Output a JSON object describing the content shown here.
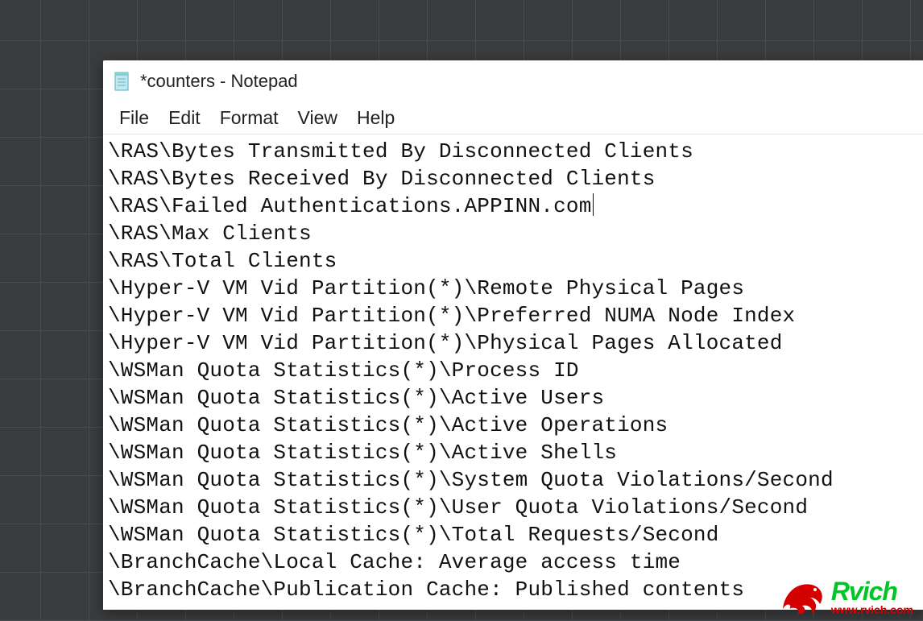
{
  "window": {
    "title": "*counters - Notepad"
  },
  "menu": {
    "file": "File",
    "edit": "Edit",
    "format": "Format",
    "view": "View",
    "help": "Help"
  },
  "editor": {
    "lines": [
      "\\RAS\\Bytes Transmitted By Disconnected Clients",
      "\\RAS\\Bytes Received By Disconnected Clients",
      "\\RAS\\Failed Authentications.APPINN.com",
      "\\RAS\\Max Clients",
      "\\RAS\\Total Clients",
      "\\Hyper-V VM Vid Partition(*)\\Remote Physical Pages",
      "\\Hyper-V VM Vid Partition(*)\\Preferred NUMA Node Index",
      "\\Hyper-V VM Vid Partition(*)\\Physical Pages Allocated",
      "\\WSMan Quota Statistics(*)\\Process ID",
      "\\WSMan Quota Statistics(*)\\Active Users",
      "\\WSMan Quota Statistics(*)\\Active Operations",
      "\\WSMan Quota Statistics(*)\\Active Shells",
      "\\WSMan Quota Statistics(*)\\System Quota Violations/Second",
      "\\WSMan Quota Statistics(*)\\User Quota Violations/Second",
      "\\WSMan Quota Statistics(*)\\Total Requests/Second",
      "\\BranchCache\\Local Cache: Average access time",
      "\\BranchCache\\Publication Cache: Published contents"
    ],
    "caret_line": 2
  },
  "watermark": {
    "name": "Rvich",
    "url": "www.rvich.com"
  }
}
